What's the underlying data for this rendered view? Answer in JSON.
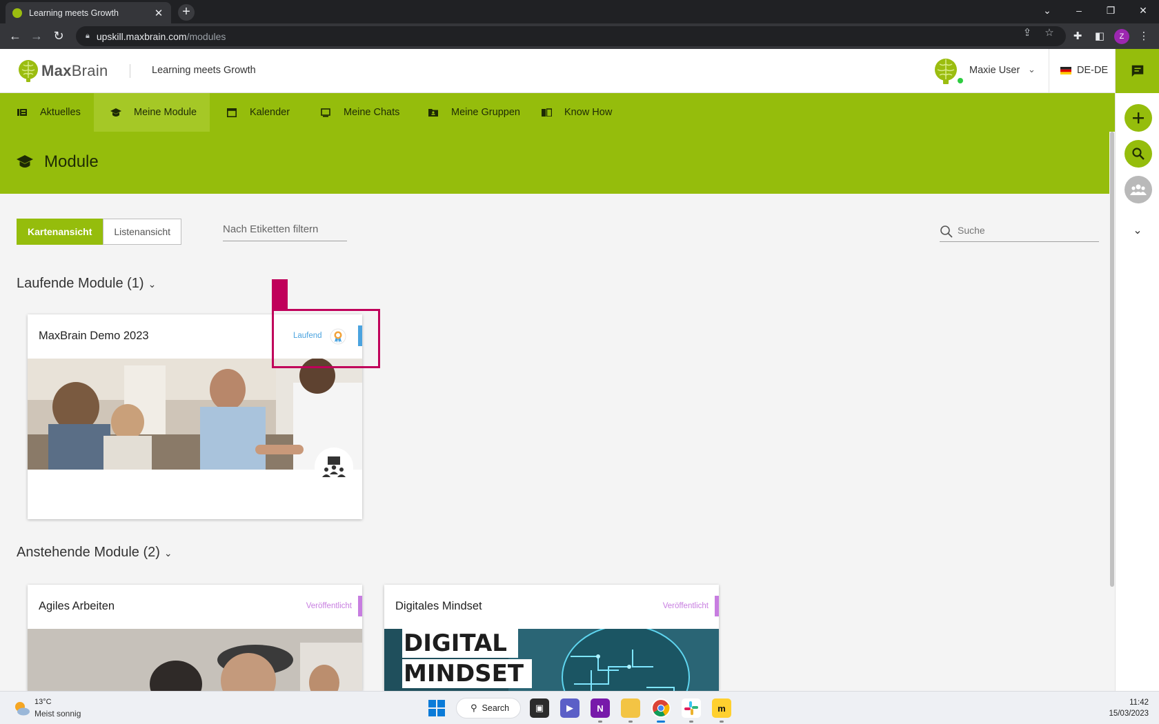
{
  "browser": {
    "tab_title": "Learning meets Growth",
    "url_host": "upskill.maxbrain.com",
    "url_path": "/modules",
    "profile_initial": "Z"
  },
  "header": {
    "logo_bold": "Max",
    "logo_light": "Brain",
    "tagline": "Learning meets Growth",
    "user_name": "Maxie User",
    "language": "DE-DE"
  },
  "nav": {
    "items": [
      {
        "label": "Aktuelles",
        "icon": "newspaper-icon"
      },
      {
        "label": "Meine Module",
        "icon": "graduation-cap-icon"
      },
      {
        "label": "Kalender",
        "icon": "calendar-icon"
      },
      {
        "label": "Meine Chats",
        "icon": "monitor-chat-icon"
      },
      {
        "label": "Meine Gruppen",
        "icon": "group-folder-icon"
      },
      {
        "label": "Know How",
        "icon": "book-icon"
      }
    ],
    "active": "Meine Module"
  },
  "page": {
    "title": "Module"
  },
  "toolbar": {
    "card_view_label": "Kartenansicht",
    "list_view_label": "Listenansicht",
    "tag_filter_placeholder": "Nach Etiketten filtern",
    "search_placeholder": "Suche"
  },
  "sections": {
    "running": {
      "title": "Laufende Module (1)",
      "cards": [
        {
          "title": "MaxBrain Demo 2023",
          "status": "Laufend",
          "status_color": "#4aa3df"
        }
      ]
    },
    "upcoming": {
      "title": "Anstehende Module (2)",
      "cards": [
        {
          "title": "Agiles Arbeiten",
          "status": "Veröffentlicht",
          "status_color": "#c77de0"
        },
        {
          "title": "Digitales Mindset",
          "status": "Veröffentlicht",
          "status_color": "#c77de0",
          "image_text_1": "DIGITAL",
          "image_text_2": "MINDSET"
        }
      ]
    }
  },
  "colors": {
    "brand_green": "#95bd0c",
    "highlight": "#c0005a"
  },
  "taskbar": {
    "temperature": "13°C",
    "weather": "Meist sonnig",
    "search_label": "Search",
    "time": "11:42",
    "date": "15/03/2023"
  }
}
